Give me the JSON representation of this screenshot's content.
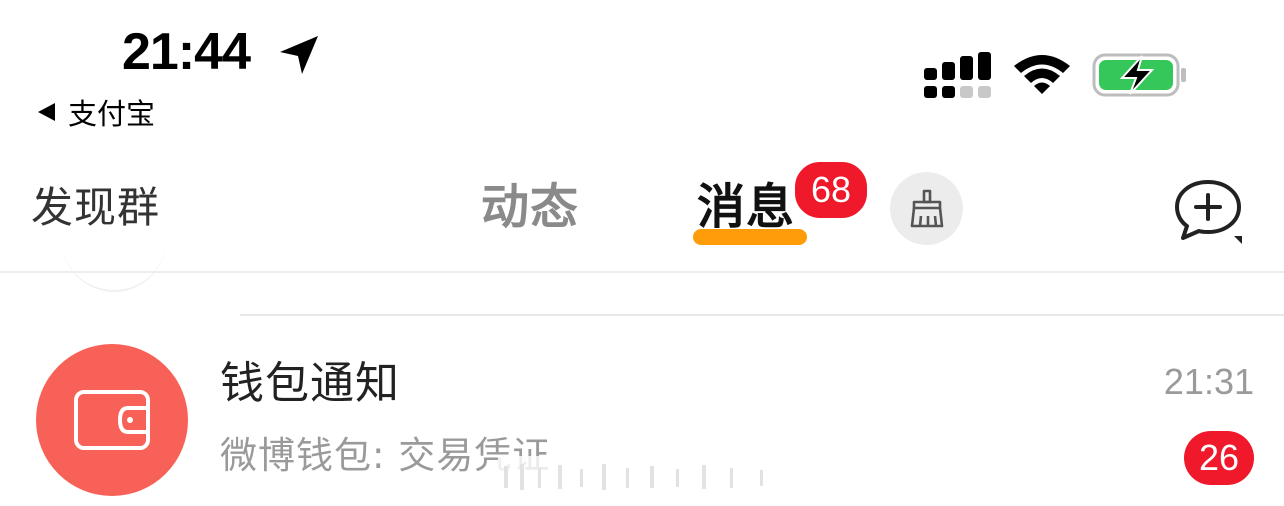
{
  "status_bar": {
    "time": "21:44",
    "back_app_label": "支付宝",
    "icons": [
      "location-arrow-icon",
      "cellular-signal-icon",
      "wifi-icon",
      "battery-charging-icon"
    ]
  },
  "nav": {
    "left_label": "发现群",
    "tabs": [
      {
        "label": "动态",
        "selected": false
      },
      {
        "label": "消息",
        "selected": true,
        "badge": "68"
      }
    ],
    "icons": [
      "broom-icon",
      "add-chat-icon"
    ]
  },
  "messages": [
    {
      "title": "钱包通知",
      "time": "21:31",
      "preview": "微博钱包: 交易凭证",
      "unread": "26",
      "avatar_icon": "wallet-icon"
    }
  ],
  "colors": {
    "badge_red": "#f0182b",
    "tab_underline": "#ff9c0a",
    "wallet_avatar": "#f76157",
    "battery_green": "#35c759"
  }
}
